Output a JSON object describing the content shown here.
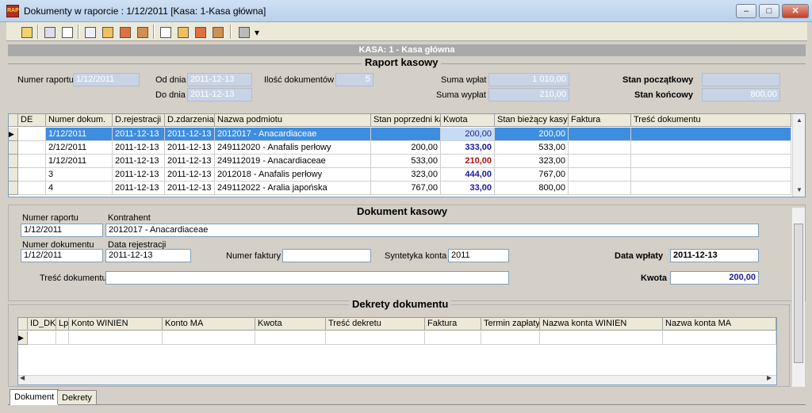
{
  "window": {
    "title": "Dokumenty w raporcie : 1/12/2011 [Kasa: 1-Kasa główna]",
    "minimize": "–",
    "maximize": "□",
    "close": "✕",
    "app_icon": "RAP"
  },
  "toolbar": {
    "icons": [
      "folder-up-icon",
      "save-icon",
      "document-icon",
      "export-icon",
      "bank-import-icon",
      "bank-export-icon",
      "document-2-icon",
      "bank-import-2-icon",
      "bank-export-2-icon",
      "bank-export-3-icon",
      "print-icon"
    ],
    "dropdown": "▾"
  },
  "kasa_bar": "KASA: 1 - Kasa główna",
  "raport": {
    "title": "Raport kasowy",
    "numer_label": "Numer raportu",
    "numer_value": "1/12/2011",
    "od_label": "Od dnia",
    "od_value": "2011-12-13",
    "do_label": "Do dnia",
    "do_value": "2011-12-13",
    "ilosc_label": "Ilość dokumentów",
    "ilosc_value": "5",
    "suma_wplat_label": "Suma wpłat",
    "suma_wplat_value": "1 010,00",
    "suma_wyplat_label": "Suma wypłat",
    "suma_wyplat_value": "210,00",
    "stan_pocz_label": "Stan początkowy",
    "stan_pocz_value": "",
    "stan_konc_label": "Stan końcowy",
    "stan_konc_value": "800,00"
  },
  "docs_table": {
    "columns": [
      "DE",
      "Numer dokum.",
      "D.rejestracji",
      "D.zdarzenia",
      "Nazwa podmiotu",
      "Stan poprzedni kasy",
      "Kwota",
      "Stan bieżący kasy",
      "Faktura",
      "Treść dokumentu"
    ],
    "rows": [
      {
        "num": "1/12/2011",
        "drej": "2011-12-13",
        "dzd": "2011-12-13",
        "nazwa": "2012017 - Anacardiaceae",
        "stan_pop": "",
        "kwota": "200,00",
        "stan_biez": "200,00",
        "color": "blue"
      },
      {
        "num": "2/12/2011",
        "drej": "2011-12-13",
        "dzd": "2011-12-13",
        "nazwa": "249112020 - Anafalis perłowy",
        "stan_pop": "200,00",
        "kwota": "333,00",
        "stan_biez": "533,00",
        "color": "blue"
      },
      {
        "num": "1/12/2011",
        "drej": "2011-12-13",
        "dzd": "2011-12-13",
        "nazwa": "249112019 - Anacardiaceae",
        "stan_pop": "533,00",
        "kwota": "210,00",
        "stan_biez": "323,00",
        "color": "red"
      },
      {
        "num": "3",
        "drej": "2011-12-13",
        "dzd": "2011-12-13",
        "nazwa": "2012018 - Anafalis perłowy",
        "stan_pop": "323,00",
        "kwota": "444,00",
        "stan_biez": "767,00",
        "color": "blue"
      },
      {
        "num": "4",
        "drej": "2011-12-13",
        "dzd": "2011-12-13",
        "nazwa": "249112022 - Aralia japońska",
        "stan_pop": "767,00",
        "kwota": "33,00",
        "stan_biez": "800,00",
        "color": "blue"
      }
    ]
  },
  "dokument": {
    "title": "Dokument kasowy",
    "numer_raportu_label": "Numer raportu",
    "numer_raportu_value": "1/12/2011",
    "kontrahent_label": "Kontrahent",
    "kontrahent_value": "2012017 - Anacardiaceae",
    "numer_dok_label": "Numer dokumentu",
    "numer_dok_value": "1/12/2011",
    "data_rej_label": "Data rejestracji",
    "data_rej_value": "2011-12-13",
    "numer_faktury_label": "Numer faktury",
    "numer_faktury_value": "",
    "syntetyka_label": "Syntetyka konta",
    "syntetyka_value": "2011",
    "data_wplaty_label": "Data wpłaty",
    "data_wplaty_value": "2011-12-13",
    "tresc_label": "Treść dokumentu",
    "tresc_value": "",
    "kwota_label": "Kwota",
    "kwota_value": "200,00"
  },
  "dekrety": {
    "title": "Dekrety dokumentu",
    "columns": [
      "ID_DK",
      "Lp",
      "Konto WINIEN",
      "Konto MA",
      "Kwota",
      "Treść dekretu",
      "Faktura",
      "Termin zapłaty",
      "Nazwa konta WINIEN",
      "Nazwa konta MA"
    ]
  },
  "tabs": [
    "Dokument",
    "Dekrety"
  ]
}
